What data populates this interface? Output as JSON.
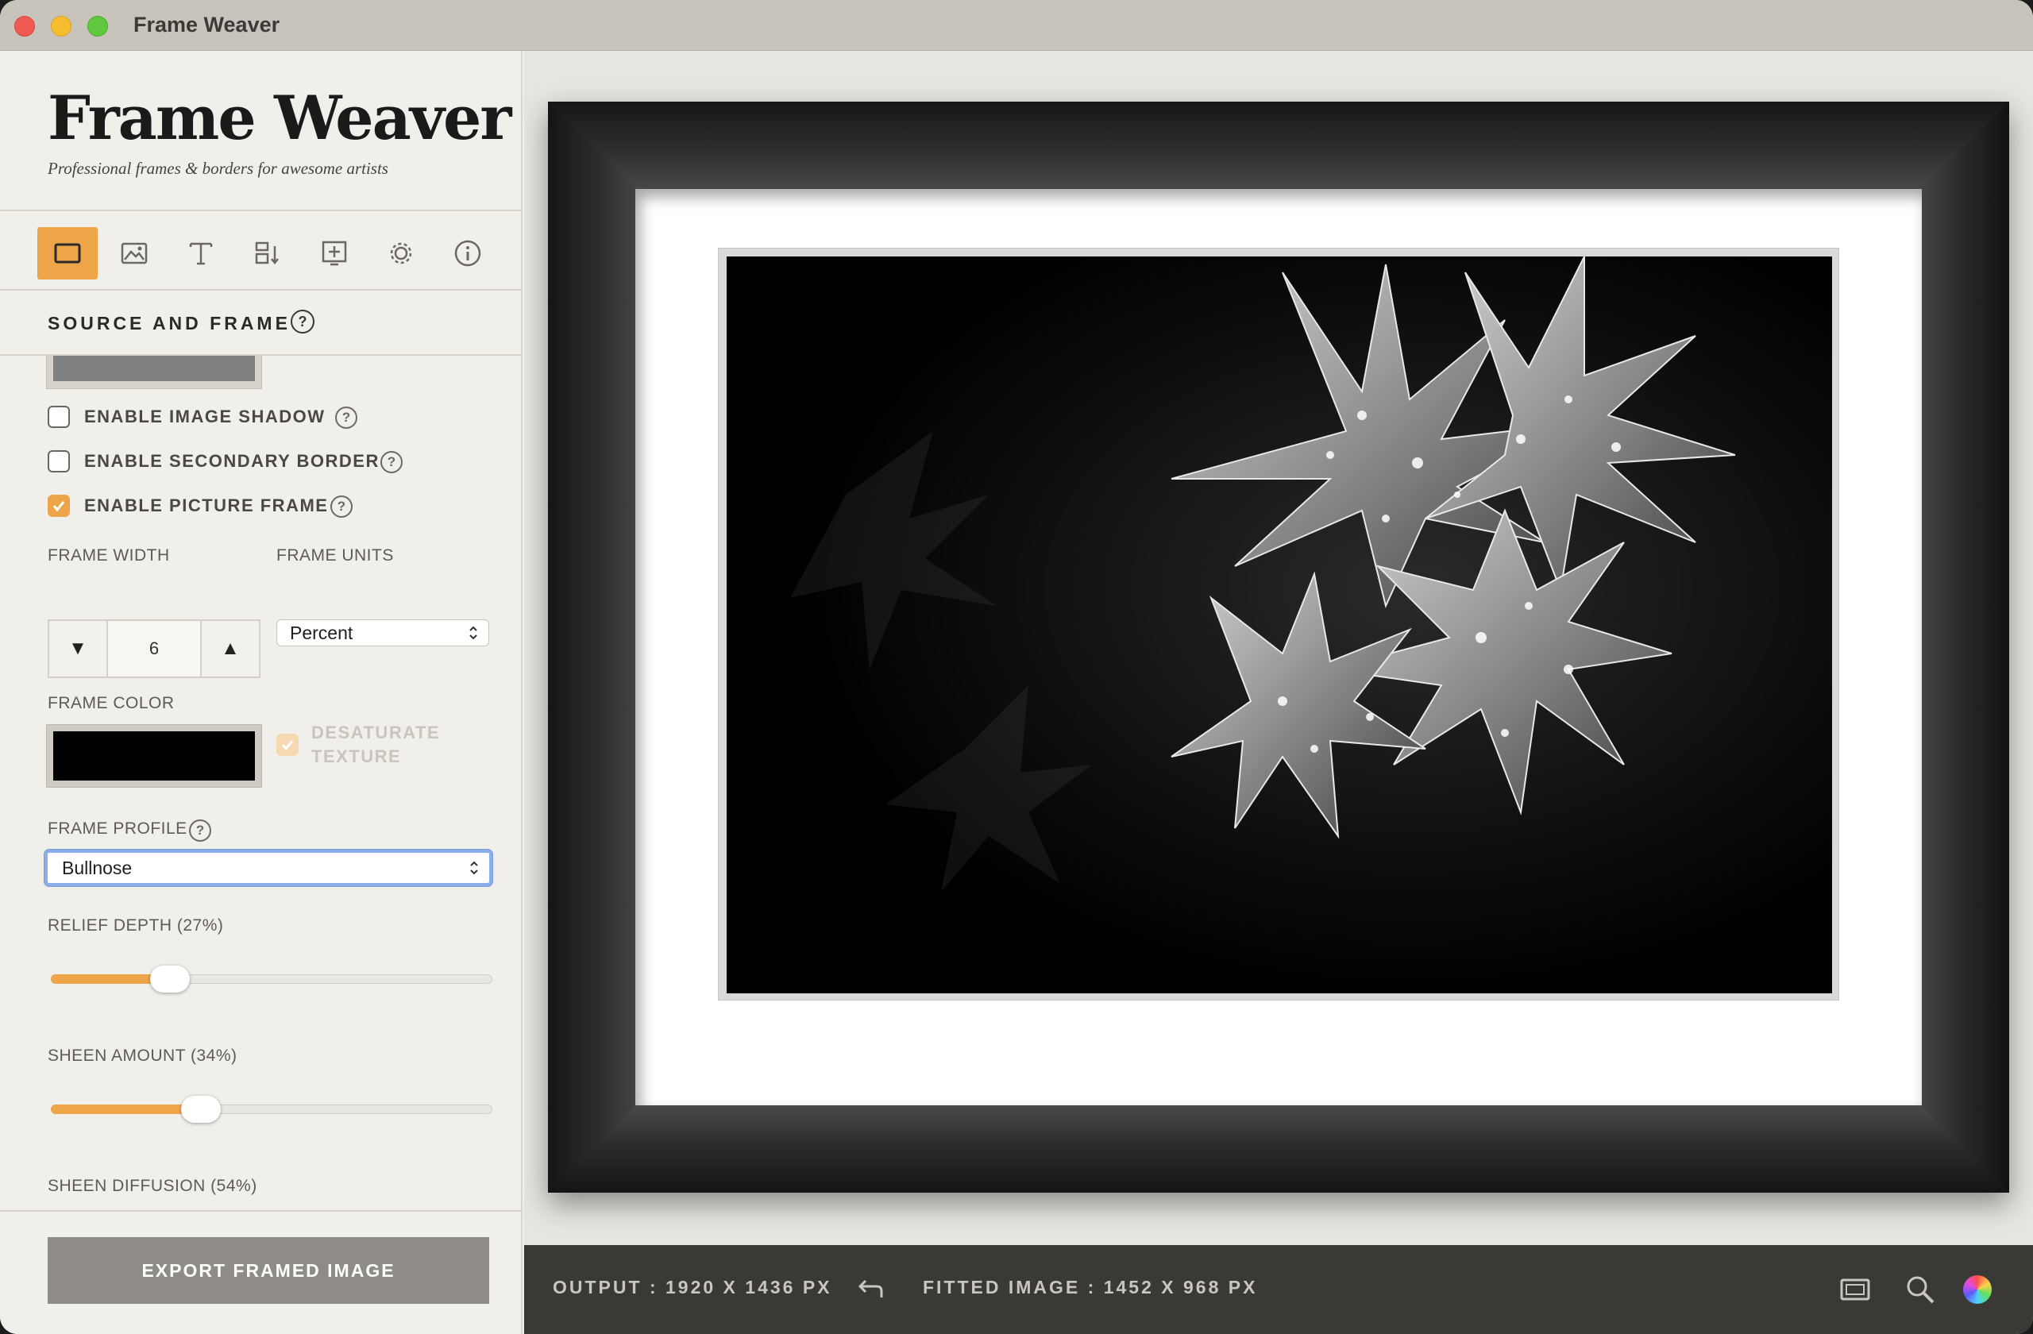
{
  "window": {
    "title": "Frame Weaver"
  },
  "sidebar": {
    "brand": "Frame Weaver",
    "tagline": "Professional frames & borders for awesome artists",
    "tools": [
      "source-frame",
      "image",
      "text",
      "align",
      "add",
      "settings",
      "info"
    ],
    "section_title": "SOURCE AND FRAME",
    "help_glyph": "?",
    "options": {
      "image_shadow": {
        "label": "ENABLE IMAGE SHADOW",
        "checked": false
      },
      "secondary_border": {
        "label": "ENABLE SECONDARY BORDER",
        "checked": false
      },
      "picture_frame": {
        "label": "ENABLE PICTURE FRAME",
        "checked": true
      }
    },
    "frame_width": {
      "label": "FRAME WIDTH",
      "value": "6",
      "down": "▼",
      "up": "▲"
    },
    "frame_units": {
      "label": "FRAME UNITS",
      "value": "Percent"
    },
    "frame_color": {
      "label": "FRAME COLOR",
      "color": "#000000"
    },
    "desaturate": {
      "label_line1": "DESATURATE",
      "label_line2": "TEXTURE",
      "checked": true,
      "disabled": true
    },
    "frame_profile": {
      "label": "FRAME PROFILE",
      "value": "Bullnose"
    },
    "relief_depth": {
      "label": "RELIEF DEPTH (27%)",
      "value": 0.27
    },
    "sheen_amount": {
      "label": "SHEEN AMOUNT (34%)",
      "value": 0.34
    },
    "sheen_diffusion": {
      "label": "SHEEN DIFFUSION (54%)",
      "value": 0.54
    },
    "export_label": "EXPORT FRAMED IMAGE"
  },
  "status": {
    "output": "OUTPUT : 1920 X 1436 PX",
    "fitted": "FITTED IMAGE : 1452 X 968 PX",
    "icons": [
      "undo-arrow-icon",
      "frame-view-icon",
      "zoom-icon",
      "color-wheel-icon"
    ]
  },
  "colors": {
    "accent": "#eea54a",
    "frame": "#1b1b1b",
    "mat": "#ffffff",
    "status_bg": "#3a3935"
  }
}
